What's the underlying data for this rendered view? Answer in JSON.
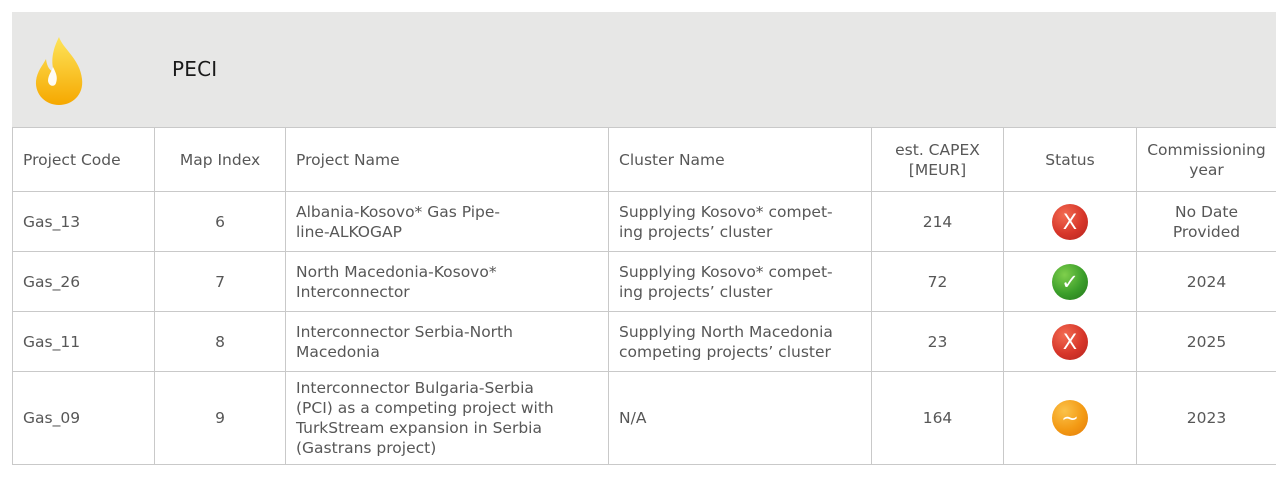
{
  "banner": {
    "title": "PECI",
    "icon": "flame-icon"
  },
  "table": {
    "headers": [
      "Project Code",
      "Map Index",
      "Project Name",
      "Cluster Name",
      "est. CAPEX [MEUR]",
      "Status",
      "Commissioning year"
    ],
    "rows": [
      {
        "code": "Gas_13",
        "map_index": "6",
        "name_lines": [
          "Albania-Kosovo* Gas Pipe-",
          "line-ALKOGAP"
        ],
        "cluster_lines": [
          "Supplying Kosovo* compet-",
          "ing projects’ cluster"
        ],
        "capex": "214",
        "status": {
          "symbol": "X",
          "icon": "x-status-icon",
          "color": "#d7362a"
        },
        "year_lines": [
          "No Date",
          "Provided"
        ]
      },
      {
        "code": "Gas_26",
        "map_index": "7",
        "name_lines": [
          "North Macedonia-Kosovo*",
          "Interconnector"
        ],
        "cluster_lines": [
          "Supplying Kosovo* compet-",
          "ing projects’ cluster"
        ],
        "capex": "72",
        "status": {
          "symbol": "✓",
          "icon": "check-status-icon",
          "color": "#3b9e2a"
        },
        "year_lines": [
          "2024"
        ]
      },
      {
        "code": "Gas_11",
        "map_index": "8",
        "name_lines": [
          "Interconnector Serbia-North",
          "Macedonia"
        ],
        "cluster_lines": [
          "Supplying North Macedonia",
          "competing projects’ cluster"
        ],
        "capex": "23",
        "status": {
          "symbol": "X",
          "icon": "x-status-icon",
          "color": "#d7362a"
        },
        "year_lines": [
          "2025"
        ]
      },
      {
        "code": "Gas_09",
        "map_index": "9",
        "name_lines": [
          "Interconnector Bulgaria-Serbia",
          "(PCI) as a competing project with",
          "TurkStream expansion in Serbia",
          "(Gastrans project)"
        ],
        "cluster_lines": [
          "N/A"
        ],
        "capex": "164",
        "status": {
          "symbol": "~",
          "icon": "tilde-status-icon",
          "color": "#f39a14"
        },
        "year_lines": [
          "2023"
        ]
      }
    ]
  }
}
